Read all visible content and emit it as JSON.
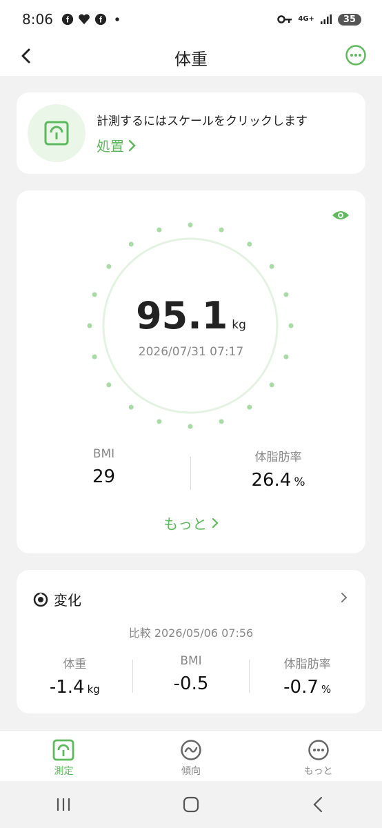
{
  "status": {
    "time": "8:06",
    "network": "4G+",
    "battery": "35"
  },
  "header": {
    "title": "体重"
  },
  "scale_card": {
    "message": "計測するにはスケールをクリックします",
    "action_label": "処置"
  },
  "measurement": {
    "weight": "95.1",
    "weight_unit": "kg",
    "timestamp": "2026/07/31 07:17",
    "bmi_label": "BMI",
    "bmi_value": "29",
    "fat_label": "体脂肪率",
    "fat_value": "26.4",
    "fat_unit": "%",
    "more_label": "もっと"
  },
  "change": {
    "title": "変化",
    "compare_text": "比較 2026/05/06 07:56",
    "weight_label": "体重",
    "weight_value": "-1.4",
    "weight_unit": "kg",
    "bmi_label": "BMI",
    "bmi_value": "-0.5",
    "fat_label": "体脂肪率",
    "fat_value": "-0.7",
    "fat_unit": "%"
  },
  "nav": {
    "measure": "測定",
    "trend": "傾向",
    "more": "もっと"
  },
  "colors": {
    "accent": "#5cba5c",
    "ring": "#e3f3e1",
    "dots": "#a8dca4"
  }
}
